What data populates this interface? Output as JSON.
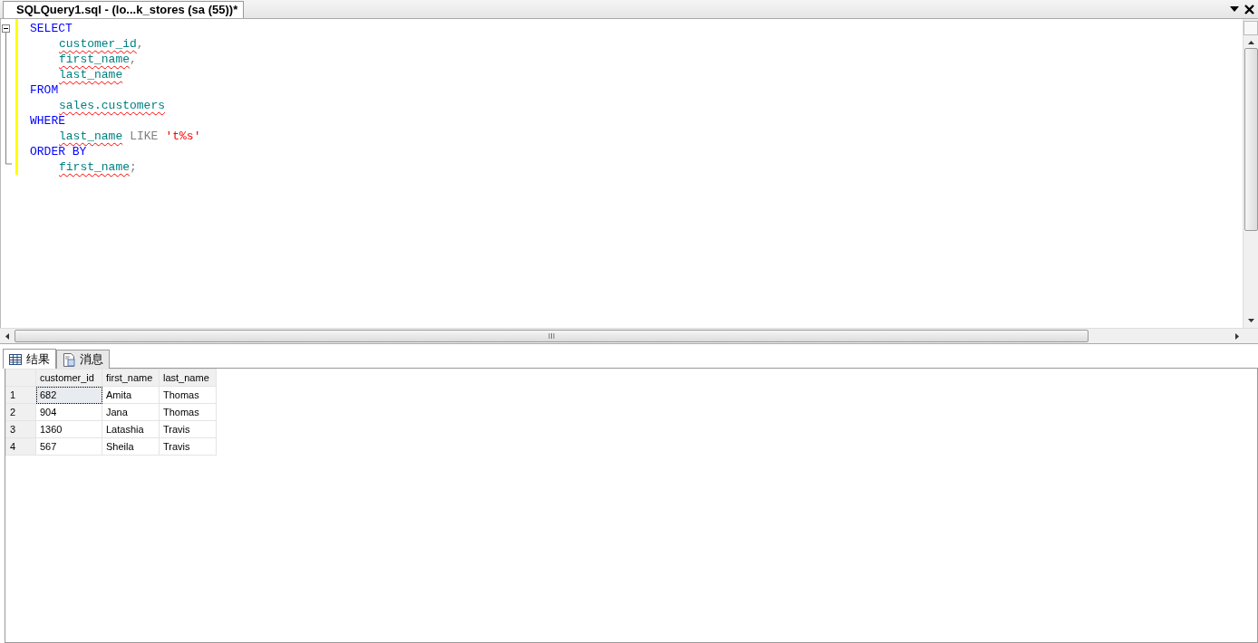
{
  "document_tab": {
    "title": "SQLQuery1.sql - (lo...k_stores (sa (55))*"
  },
  "editor": {
    "lines": [
      {
        "indented": false,
        "tokens": [
          {
            "text": "SELECT",
            "kind": "keyword"
          }
        ]
      },
      {
        "indented": true,
        "tokens": [
          {
            "text": "customer_id",
            "kind": "identifier"
          },
          {
            "text": ",",
            "kind": "punct"
          }
        ]
      },
      {
        "indented": true,
        "tokens": [
          {
            "text": "first_name",
            "kind": "identifier"
          },
          {
            "text": ",",
            "kind": "punct"
          }
        ]
      },
      {
        "indented": true,
        "tokens": [
          {
            "text": "last_name",
            "kind": "identifier"
          }
        ]
      },
      {
        "indented": false,
        "tokens": [
          {
            "text": "FROM",
            "kind": "keyword"
          }
        ]
      },
      {
        "indented": true,
        "tokens": [
          {
            "text": "sales.customers",
            "kind": "identifier"
          }
        ]
      },
      {
        "indented": false,
        "tokens": [
          {
            "text": "WHERE",
            "kind": "keyword"
          }
        ]
      },
      {
        "indented": true,
        "tokens": [
          {
            "text": "last_name",
            "kind": "identifier"
          },
          {
            "text": "LIKE",
            "kind": "operator"
          },
          {
            "text": "'t%s'",
            "kind": "string"
          }
        ]
      },
      {
        "indented": false,
        "tokens": [
          {
            "text": "ORDER BY",
            "kind": "keyword"
          }
        ]
      },
      {
        "indented": true,
        "tokens": [
          {
            "text": "first_name",
            "kind": "identifier"
          },
          {
            "text": ";",
            "kind": "punct"
          }
        ]
      }
    ]
  },
  "result_tabs": [
    {
      "label": "结果",
      "selected": true
    },
    {
      "label": "消息",
      "selected": false
    }
  ],
  "grid": {
    "columns": [
      "customer_id",
      "first_name",
      "last_name"
    ],
    "rows": [
      {
        "number": "1",
        "focused": true,
        "cells": [
          "682",
          "Amita",
          "Thomas"
        ]
      },
      {
        "number": "2",
        "focused": false,
        "cells": [
          "904",
          "Jana",
          "Thomas"
        ]
      },
      {
        "number": "3",
        "focused": false,
        "cells": [
          "1360",
          "Latashia",
          "Travis"
        ]
      },
      {
        "number": "4",
        "focused": false,
        "cells": [
          "567",
          "Sheila",
          "Travis"
        ]
      }
    ]
  }
}
